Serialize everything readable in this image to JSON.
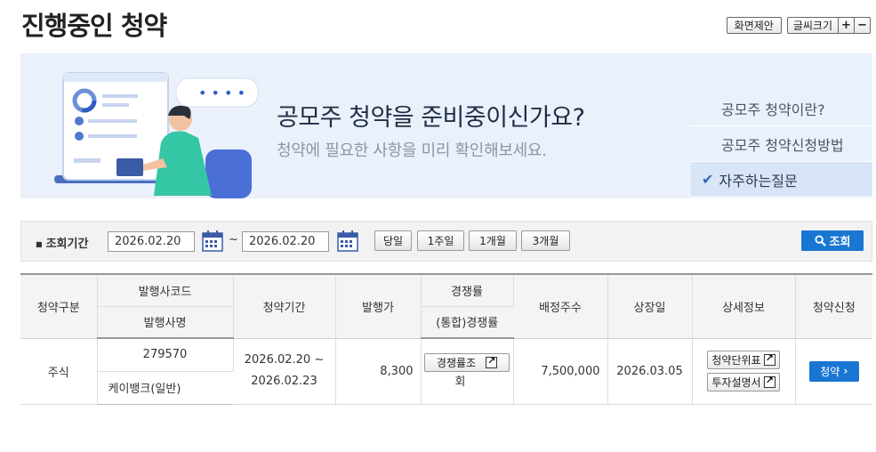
{
  "page": {
    "title": "진행중인 청약"
  },
  "tools": {
    "suggest_label": "화면제안",
    "font_size_label": "글씨크기",
    "plus": "+",
    "minus": "−"
  },
  "banner": {
    "headline": "공모주 청약을 준비중이신가요?",
    "sub": "청약에 필요한 사항을 미리 확인해보세요.",
    "menu": [
      {
        "label": "공모주 청약이란?",
        "active": false
      },
      {
        "label": "공모주 청약신청방법",
        "active": false
      },
      {
        "label": "자주하는질문",
        "active": true
      }
    ],
    "check_glyph": "✔",
    "chat_dots": "• • • •"
  },
  "search": {
    "label": "조회기간",
    "start_date": "2026.02.20",
    "end_date": "2026.02.20",
    "tilde": "~",
    "periods": [
      "당일",
      "1주일",
      "1개월",
      "3개월"
    ],
    "query_label": "조회"
  },
  "table": {
    "headers": {
      "type": "청약구분",
      "issuer_code": "발행사코드",
      "issuer_name": "발행사명",
      "period": "청약기간",
      "price": "발행가",
      "competition": "경쟁률",
      "competition_total": "(통합)경쟁률",
      "allocation": "배정주수",
      "listing": "상장일",
      "detail": "상세정보",
      "apply": "청약신청"
    },
    "rows": [
      {
        "type": "주식",
        "issuer_code": "279570",
        "issuer_name": "케이뱅크(일반)",
        "period_start": "2026.02.20 ~",
        "period_end": "2026.02.23",
        "price": "8,300",
        "competition_btn_line1": "경쟁률조",
        "competition_btn_line2": "회",
        "allocation": "7,500,000",
        "listing": "2026.03.05",
        "detail_btn1": "청약단위표",
        "detail_btn2": "투자설명서",
        "apply_btn": "청약",
        "apply_arrow": "›"
      }
    ]
  },
  "colors": {
    "accent": "#1976d2",
    "banner_bg": "#eaf1fb",
    "headline": "#1f2d46"
  }
}
